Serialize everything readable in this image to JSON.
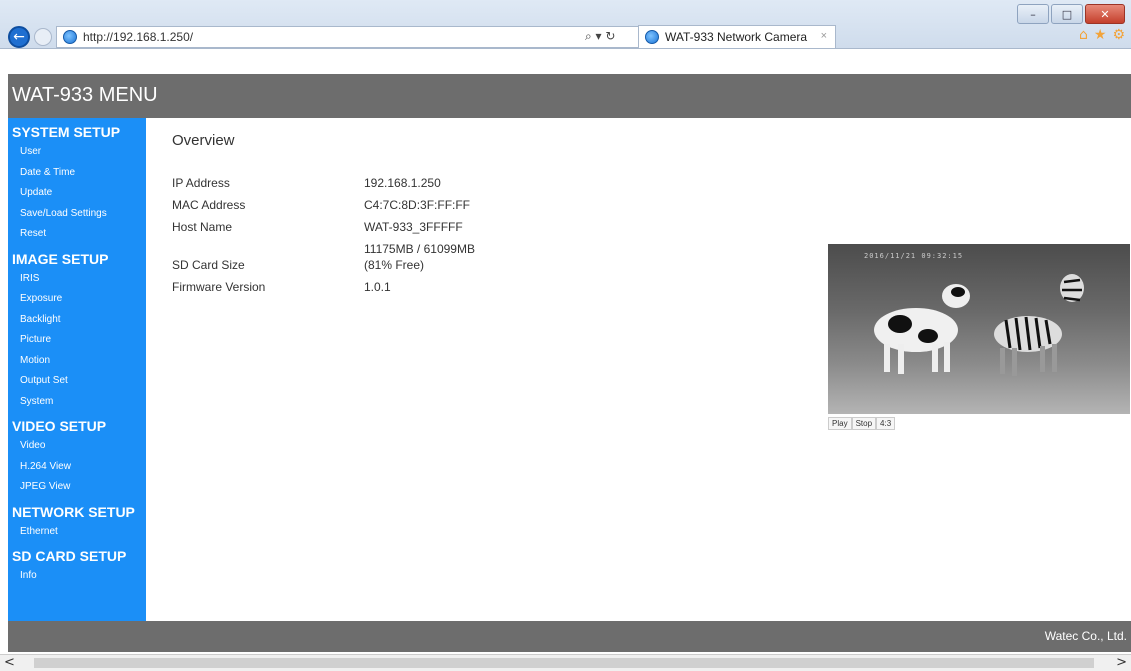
{
  "browser": {
    "url": "http://192.168.1.250/",
    "tab_title": "WAT-933 Network Camera",
    "tab_close": "×",
    "search_glyph": "⌕ ▾ ↻",
    "window_buttons": {
      "minimize": "–",
      "maximize": "□",
      "close": "✕"
    },
    "back_glyph": "←",
    "tools": {
      "home": "⌂",
      "star": "★",
      "gear": "⚙"
    }
  },
  "page": {
    "title": "WAT-933 MENU",
    "footer": "Watec Co., Ltd.",
    "overview_heading": "Overview"
  },
  "sidebar": {
    "sections": [
      {
        "title": "SYSTEM SETUP",
        "items": [
          "User",
          "Date & Time",
          "Update",
          "Save/Load Settings",
          "Reset"
        ]
      },
      {
        "title": "IMAGE SETUP",
        "items": [
          "IRIS",
          "Exposure",
          "Backlight",
          "Picture",
          "Motion",
          "Output Set",
          "System"
        ]
      },
      {
        "title": "VIDEO SETUP",
        "items": [
          "Video",
          "H.264 View",
          "JPEG View"
        ]
      },
      {
        "title": "NETWORK SETUP",
        "items": [
          "Ethernet"
        ]
      },
      {
        "title": "SD CARD SETUP",
        "items": [
          "Info"
        ]
      }
    ]
  },
  "overview": {
    "ip_label": "IP Address",
    "ip_value": "192.168.1.250",
    "mac_label": "MAC Address",
    "mac_value": "C4:7C:8D:3F:FF:FF",
    "host_label": "Host Name",
    "host_value": "WAT-933_3FFFFF",
    "sd_label": "SD Card Size",
    "sd_value_line1": "11175MB / 61099MB",
    "sd_value_line2": "(81% Free)",
    "fw_label": "Firmware Version",
    "fw_value": "1.0.1"
  },
  "video": {
    "timestamp": "2016/11/21 09:32:15",
    "play_label": "Play",
    "stop_label": "Stop",
    "ratio_label": "4:3"
  },
  "scrollbar": {
    "left": "<",
    "right": ">"
  }
}
